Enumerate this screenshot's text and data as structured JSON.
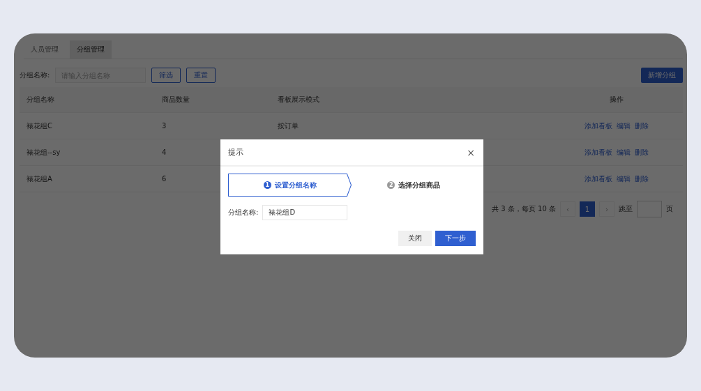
{
  "tabs": [
    {
      "label": "人员管理",
      "selected": false
    },
    {
      "label": "分组管理",
      "selected": true
    }
  ],
  "filter": {
    "label": "分组名称:",
    "placeholder": "请输入分组名称",
    "buttons": [
      "筛选",
      "重置"
    ]
  },
  "add_button": "新增分组",
  "table": {
    "columns": [
      "分组名称",
      "商品数量",
      "看板展示模式",
      "操作"
    ],
    "rows": [
      {
        "name": "裱花组C",
        "count": "3",
        "mode": "按订单",
        "actions": [
          "添加看板",
          "编辑",
          "删除"
        ]
      },
      {
        "name": "裱花组--sy",
        "count": "4",
        "actions": [
          "添加看板",
          "编辑",
          "删除"
        ]
      },
      {
        "name": "裱花组A",
        "count": "6",
        "actions": [
          "添加看板",
          "编辑",
          "删除"
        ]
      }
    ]
  },
  "pagination": {
    "summary": "共 3 条，每页 10 条",
    "prev": "‹",
    "pages": [
      {
        "label": "1",
        "selected": true
      }
    ],
    "next": "›",
    "jump_label": "跳至",
    "jump_suffix": "页"
  },
  "dialog": {
    "title": "提示",
    "close": "×",
    "steps": [
      {
        "number": "1",
        "label": "设置分组名称",
        "selected": true
      },
      {
        "number": "2",
        "label": "选择分组商品",
        "selected": false
      }
    ],
    "field": {
      "label": "分组名称:",
      "value": "裱花组D"
    },
    "buttons": [
      {
        "label": "关闭",
        "kind": "default"
      },
      {
        "label": "下一步",
        "kind": "primary"
      }
    ]
  }
}
